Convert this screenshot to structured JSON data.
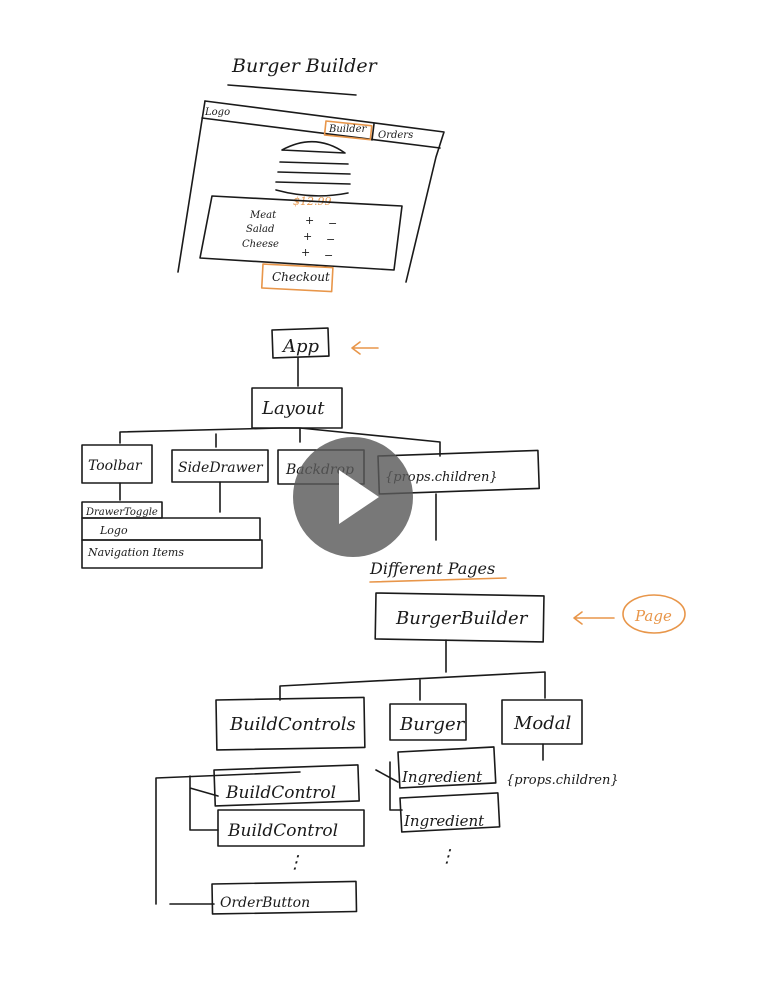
{
  "mockup": {
    "title": "Burger Builder",
    "logo": "Logo",
    "nav_builder": "Builder",
    "nav_orders": "Orders",
    "price": "$12.99",
    "controls": [
      {
        "label": "Meat",
        "plus": "+",
        "minus": "−"
      },
      {
        "label": "Salad",
        "plus": "+",
        "minus": "−"
      },
      {
        "label": "Cheese",
        "plus": "+",
        "minus": "−"
      }
    ],
    "checkout": "Checkout"
  },
  "tree": {
    "app": "App",
    "layout": "Layout",
    "toolbar": "Toolbar",
    "side_drawer": "SideDrawer",
    "backdrop": "Backdrop",
    "props_children": "{props.children}",
    "drawer_toggle": "DrawerToggle",
    "logo": "Logo",
    "navigation_items": "Navigation Items",
    "different_pages": "Different Pages",
    "burger_builder": "BurgerBuilder",
    "page_label": "Page",
    "build_controls": "BuildControls",
    "burger": "Burger",
    "modal": "Modal",
    "build_control_1": "BuildControl",
    "build_control_2": "BuildControl",
    "ingredient_1": "Ingredient",
    "ingredient_2": "Ingredient",
    "ellipsis_1": "⋮",
    "ellipsis_2": "⋮",
    "modal_children": "{props.children}",
    "order_button": "OrderButton"
  },
  "colors": {
    "ink": "#1a1a1a",
    "accent": "#e8964a"
  },
  "icons": {
    "play": "play-icon"
  }
}
